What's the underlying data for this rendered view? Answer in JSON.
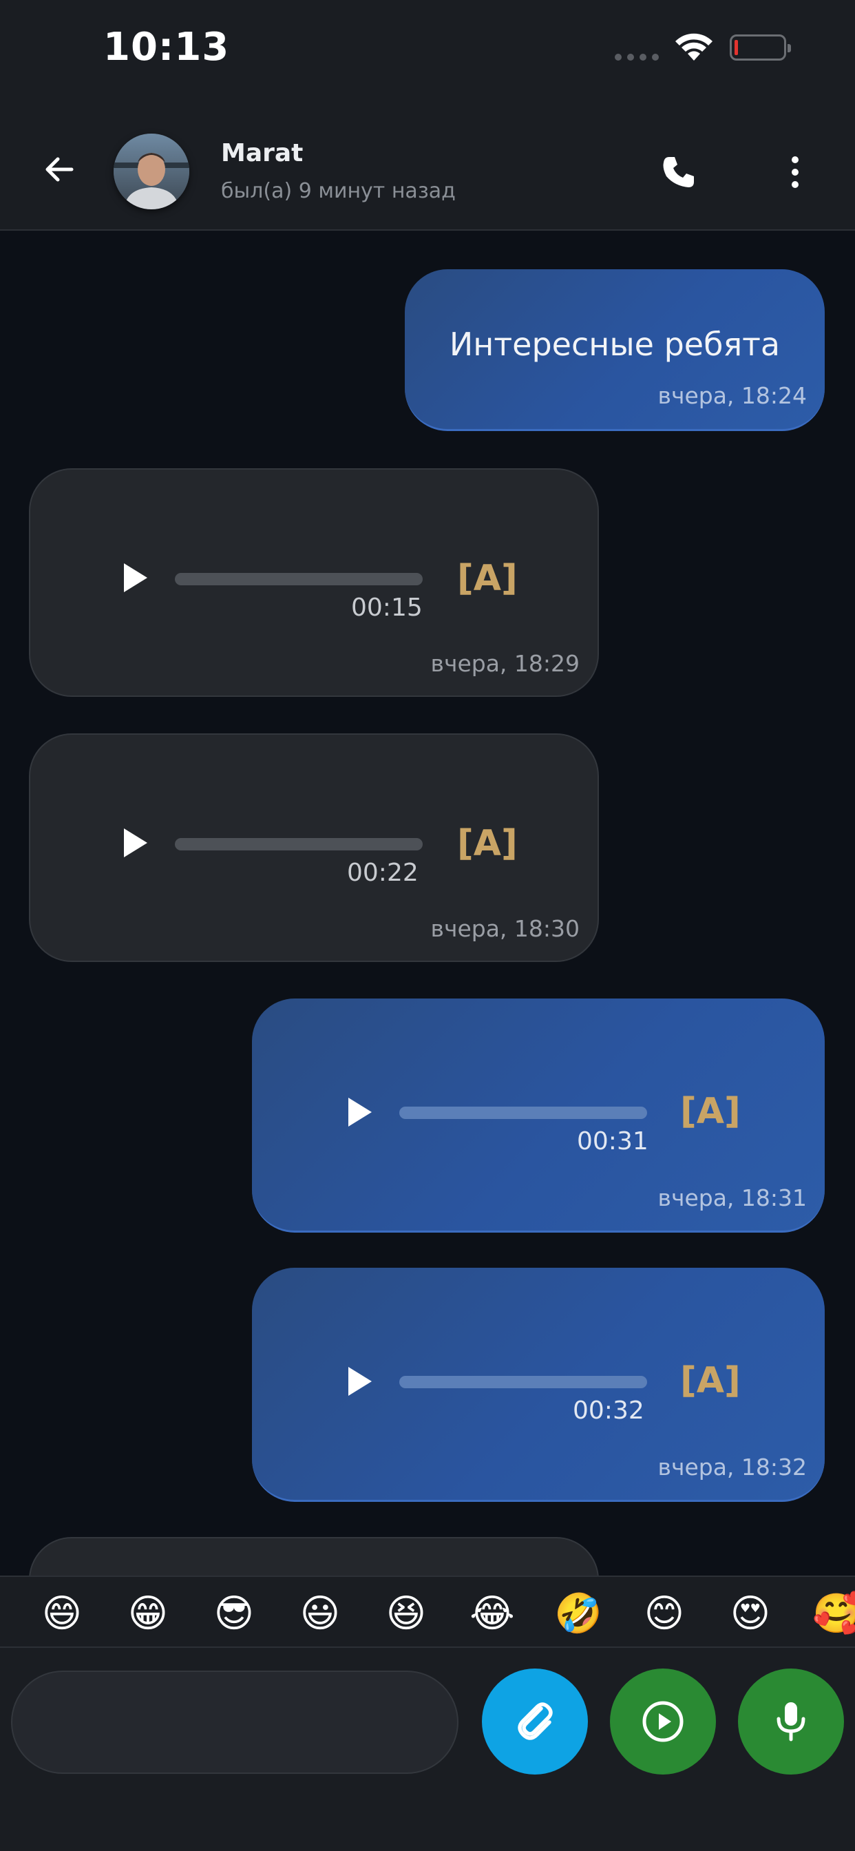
{
  "status_bar": {
    "time": "10:13"
  },
  "header": {
    "contact_name": "Marat",
    "contact_status": "был(а) 9 минут назад"
  },
  "messages": [
    {
      "direction": "out",
      "type": "text",
      "text": "Интересные ребята",
      "time": "вчера, 18:24"
    },
    {
      "direction": "in",
      "type": "voice",
      "duration": "00:15",
      "badge": "[A]",
      "time": "вчера, 18:29"
    },
    {
      "direction": "in",
      "type": "voice",
      "duration": "00:22",
      "badge": "[A]",
      "time": "вчера, 18:30"
    },
    {
      "direction": "out",
      "type": "voice",
      "duration": "00:31",
      "badge": "[A]",
      "time": "вчера, 18:31"
    },
    {
      "direction": "out",
      "type": "voice",
      "duration": "00:32",
      "badge": "[A]",
      "time": "вчера, 18:32"
    }
  ],
  "emoji_bar": [
    "😄",
    "😁",
    "😎",
    "😃",
    "😆",
    "😂",
    "🤣",
    "😊",
    "😍",
    "🥰"
  ],
  "composer": {
    "input_value": "",
    "input_placeholder": ""
  },
  "colors": {
    "outgoing_bubble": "#2a55a0",
    "incoming_bubble": "#24272c",
    "badge": "#c9a465",
    "attach_button": "#0ea3e4",
    "video_button": "#2a8a33",
    "mic_button": "#2a8a33"
  },
  "icons": {
    "back": "arrow-left-icon",
    "call": "phone-icon",
    "more": "more-vertical-icon",
    "play": "play-icon",
    "attach": "paperclip-icon",
    "video_message": "play-circle-icon",
    "mic": "microphone-icon"
  }
}
